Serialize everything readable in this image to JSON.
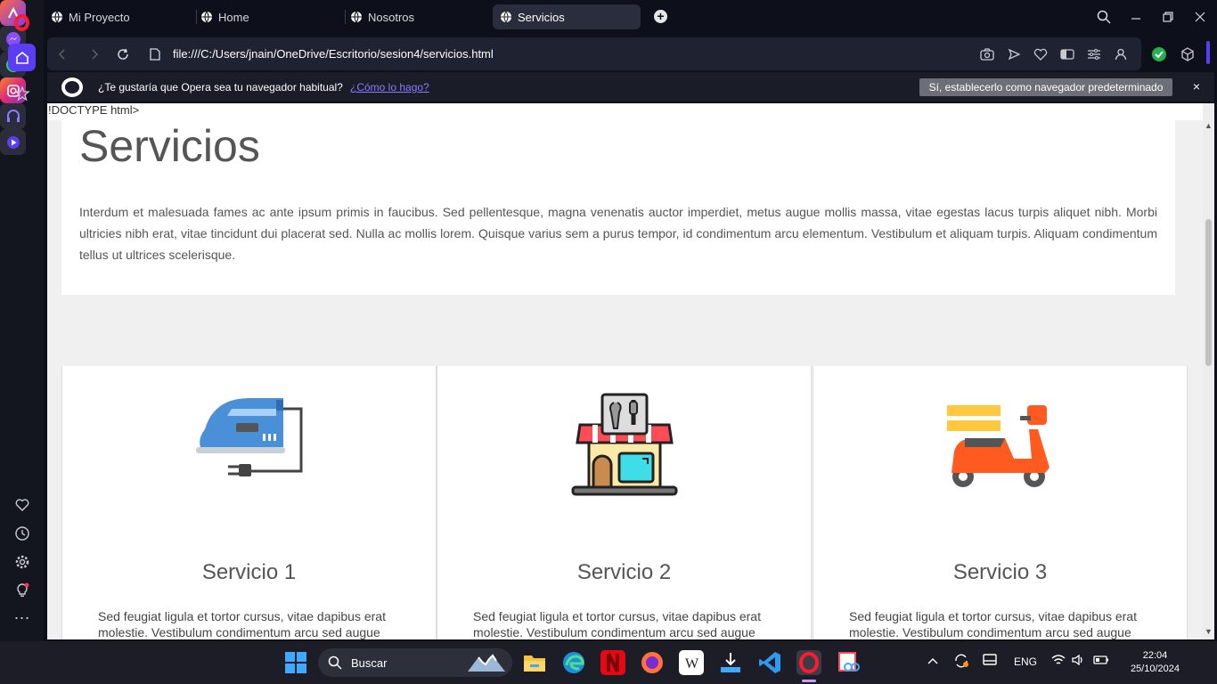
{
  "tabs": [
    {
      "label": "Mi Proyecto"
    },
    {
      "label": "Home"
    },
    {
      "label": "Nosotros"
    },
    {
      "label": "Servicios",
      "active": true
    }
  ],
  "address": {
    "url": "file:///C:/Users/jnain/OneDrive/Escritorio/sesion4/servicios.html"
  },
  "infobar": {
    "question": "¿Te gustaría que Opera sea tu navegador habitual?",
    "how_link": "¿Cómo lo hago?",
    "set_default_button": "Sí, establecerlo como navegador predeterminado",
    "close": "×"
  },
  "page": {
    "doctype_text": "!DOCTYPE html>",
    "title": "Servicios",
    "intro": "Interdum et malesuada fames ac ante ipsum primis in faucibus. Sed pellentesque, magna venenatis auctor imperdiet, metus augue mollis massa, vitae egestas lacus turpis aliquet nibh. Morbi ultricies nibh erat, vitae tincidunt dui placerat sed. Nulla ac mollis lorem. Quisque varius sem a purus tempor, id condimentum arcu elementum. Vestibulum et aliquam turpis. Aliquam condimentum tellus ut ultrices scelerisque.",
    "services": [
      {
        "title": "Servicio 1",
        "text": "Sed feugiat ligula et tortor cursus, vitae dapibus erat molestie. Vestibulum condimentum arcu sed augue",
        "icon": "iron-icon"
      },
      {
        "title": "Servicio 2",
        "text": "Sed feugiat ligula et tortor cursus, vitae dapibus erat molestie. Vestibulum condimentum arcu sed augue",
        "icon": "repair-shop-icon"
      },
      {
        "title": "Servicio 3",
        "text": "Sed feugiat ligula et tortor cursus, vitae dapibus erat molestie. Vestibulum condimentum arcu sed augue",
        "icon": "delivery-scooter-icon"
      }
    ]
  },
  "taskbar": {
    "search_placeholder": "Buscar",
    "lang": "ENG",
    "time": "22:04",
    "date": "25/10/2024"
  },
  "colors": {
    "accent": "#5b3df5",
    "opera_red": "#ff1b2d"
  }
}
